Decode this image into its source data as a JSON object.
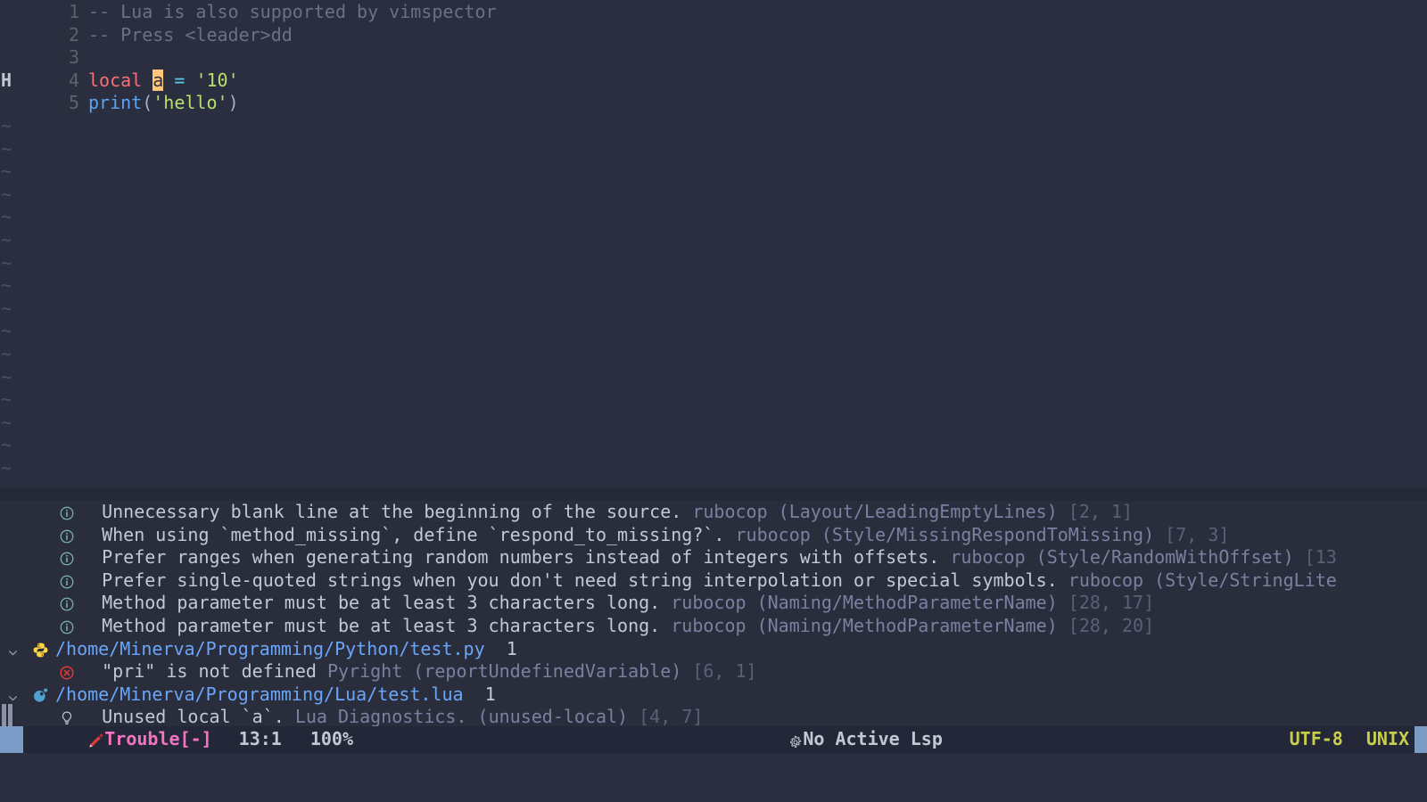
{
  "editor": {
    "sign_marker": "H",
    "tilde": "~",
    "lines": [
      {
        "num": "1",
        "segments": [
          {
            "text": "-- Lua is also supported by vimspector",
            "cls": "tok-comment"
          }
        ]
      },
      {
        "num": "2",
        "segments": [
          {
            "text": "-- Press <leader>dd",
            "cls": "tok-comment"
          }
        ]
      },
      {
        "num": "3",
        "segments": []
      },
      {
        "num": "4",
        "segments": [
          {
            "text": "local",
            "cls": "tok-keyword"
          },
          {
            "text": " ",
            "cls": "tok-plain"
          },
          {
            "text": "a",
            "cls": "cursor-block"
          },
          {
            "text": " ",
            "cls": "tok-plain"
          },
          {
            "text": "=",
            "cls": "tok-op"
          },
          {
            "text": " ",
            "cls": "tok-plain"
          },
          {
            "text": "'10'",
            "cls": "tok-string"
          }
        ]
      },
      {
        "num": "5",
        "segments": [
          {
            "text": "print",
            "cls": "tok-func"
          },
          {
            "text": "(",
            "cls": "tok-punct"
          },
          {
            "text": "'hello'",
            "cls": "tok-string"
          },
          {
            "text": ")",
            "cls": "tok-punct"
          }
        ]
      }
    ],
    "empty_line_count": 16
  },
  "trouble": {
    "rows": [
      {
        "kind": "diagnostic",
        "icon": "info-icon",
        "message": "Unnecessary blank line at the beginning of the source.",
        "source": "rubocop",
        "code": "(Layout/LeadingEmptyLines)",
        "position": "[2, 1]"
      },
      {
        "kind": "diagnostic",
        "icon": "info-icon",
        "message": "When using `method_missing`, define `respond_to_missing?`.",
        "source": "rubocop",
        "code": "(Style/MissingRespondToMissing)",
        "position": "[7, 3]"
      },
      {
        "kind": "diagnostic",
        "icon": "info-icon",
        "message": "Prefer ranges when generating random numbers instead of integers with offsets.",
        "source": "rubocop",
        "code": "(Style/RandomWithOffset)",
        "position": "[13"
      },
      {
        "kind": "diagnostic",
        "icon": "info-icon",
        "message": "Prefer single-quoted strings when you don't need string interpolation or special symbols.",
        "source": "rubocop",
        "code": "(Style/StringLite",
        "position": ""
      },
      {
        "kind": "diagnostic",
        "icon": "info-icon",
        "message": "Method parameter must be at least 3 characters long.",
        "source": "rubocop",
        "code": "(Naming/MethodParameterName)",
        "position": "[28, 17]"
      },
      {
        "kind": "diagnostic",
        "icon": "info-icon",
        "message": "Method parameter must be at least 3 characters long.",
        "source": "rubocop",
        "code": "(Naming/MethodParameterName)",
        "position": "[28, 20]"
      },
      {
        "kind": "file",
        "icon": "python-icon",
        "fold": "chevron-down-icon",
        "path": "/home/Minerva/Programming/Python/test.py",
        "count": "1"
      },
      {
        "kind": "diagnostic",
        "icon": "error-icon",
        "message": "\"pri\" is not defined",
        "source": "Pyright",
        "code": "(reportUndefinedVariable)",
        "position": "[6, 1]"
      },
      {
        "kind": "file",
        "icon": "lua-icon",
        "fold": "chevron-down-icon",
        "path": "/home/Minerva/Programming/Lua/test.lua",
        "count": "1"
      },
      {
        "kind": "diagnostic",
        "icon": "hint-icon",
        "message": "Unused local `a`.",
        "source": "Lua Diagnostics.",
        "code": "(unused-local)",
        "position": "[4, 7]"
      }
    ]
  },
  "statusline": {
    "mode_icon": "pencil-icon",
    "mode": "Trouble[-]",
    "position": "13:1",
    "percent": "100%",
    "lsp_icon": "gear-icon",
    "lsp_status": "No Active Lsp",
    "encoding": "UTF-8",
    "fileformat": "UNIX"
  },
  "colors": {
    "editor_bg": "#2a2e3e",
    "panel_bg": "#2a2e3c",
    "statusline_bg": "#232738",
    "accent": "#7a9cc6",
    "mode_fg": "#f573c0",
    "encoding_fg": "#c7cf4b",
    "file_path_fg": "#6ba5f8",
    "cursor_bg": "#ffc777",
    "info_icon": "#7fb3b8",
    "error_icon": "#e03a3a",
    "hint_icon": "#c3c8d4"
  }
}
